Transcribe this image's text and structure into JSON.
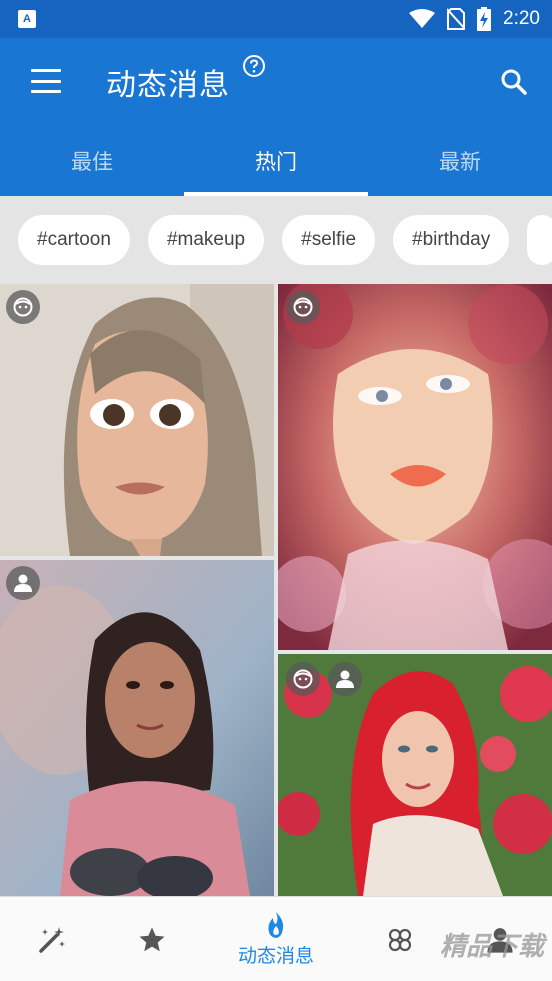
{
  "status_bar": {
    "time": "2:20",
    "app_indicator": "A"
  },
  "app_bar": {
    "title": "动态消息",
    "menu_icon": "menu-icon",
    "help_icon": "help-icon",
    "search_icon": "search-icon"
  },
  "tabs": [
    {
      "label": "最佳",
      "active": false
    },
    {
      "label": "热门",
      "active": true
    },
    {
      "label": "最新",
      "active": false
    }
  ],
  "tags": [
    "#cartoon",
    "#makeup",
    "#selfie",
    "#birthday"
  ],
  "photos": [
    {
      "name": "photo-cartoon-girl",
      "badges": [
        "face-icon"
      ]
    },
    {
      "name": "photo-floral-portrait",
      "badges": [
        "face-icon"
      ]
    },
    {
      "name": "photo-girl-double-exposure",
      "badges": [
        "person-icon"
      ]
    },
    {
      "name": "photo-red-hair-woman",
      "badges": [
        "face-icon",
        "person-icon"
      ]
    }
  ],
  "bottom_nav": {
    "items": [
      {
        "icon": "magic-wand-icon",
        "label": ""
      },
      {
        "icon": "star-icon",
        "label": ""
      },
      {
        "icon": "flame-icon",
        "label": "动态消息",
        "active": true
      },
      {
        "icon": "clover-icon",
        "label": ""
      },
      {
        "icon": "person-icon",
        "label": ""
      }
    ]
  },
  "watermark": "精品下载",
  "colors": {
    "primary": "#1976d2",
    "status_bar": "#1565c0",
    "accent": "#1e88e5"
  }
}
